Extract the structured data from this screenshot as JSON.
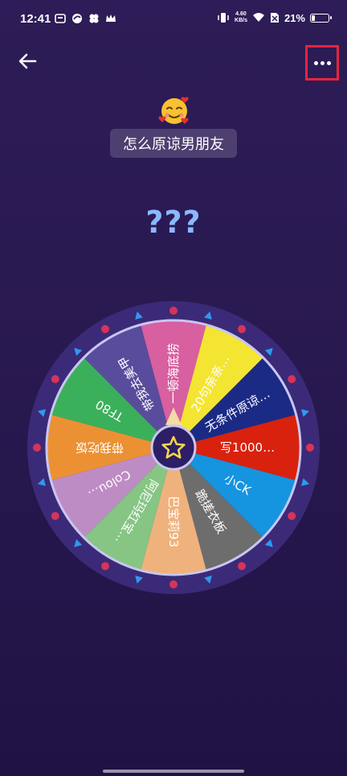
{
  "status": {
    "time": "12:41",
    "net_speed_value": "4.60",
    "net_speed_unit": "KB/s",
    "battery": "21%",
    "battery_level": 0.21
  },
  "header": {
    "back_icon": "arrow-left-icon",
    "more_icon": "more-horizontal-icon"
  },
  "title": "怎么原谅男朋友",
  "emoji": "smiling-face-with-hearts",
  "result_text": "???",
  "wheel": {
    "colors": {
      "rim": "#3b2a78",
      "dots": "#d8335a",
      "triangles": "#2a9cf0",
      "hub": "#2c1f66",
      "star": "#f5d64a"
    },
    "segments": [
      {
        "label": "一顿海底捞",
        "color": "#d85fa0"
      },
      {
        "label": "20句亲亲…",
        "color": "#f4e533"
      },
      {
        "label": "无条件原谅…",
        "color": "#1b2a85"
      },
      {
        "label": "写1000…",
        "color": "#d8220d"
      },
      {
        "label": "小CK",
        "color": "#1594e0"
      },
      {
        "label": "跪搓衣板",
        "color": "#6d6d6d"
      },
      {
        "label": "巴宝莉93",
        "color": "#f0b27c"
      },
      {
        "label": "阿尼玛红宝…",
        "color": "#86c584"
      },
      {
        "label": "Colou…",
        "color": "#be8cc4"
      },
      {
        "label": "带我吃饭",
        "color": "#eb9134"
      },
      {
        "label": "TF80",
        "color": "#3bb05a"
      },
      {
        "label": "带我去美甲",
        "color": "#5a4c9c"
      }
    ]
  }
}
